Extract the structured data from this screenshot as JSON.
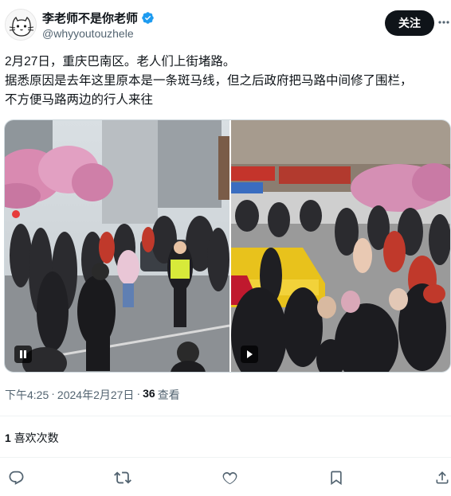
{
  "author": {
    "display_name": "李老师不是你老师",
    "handle": "@whyyoutouzhele",
    "verified": true
  },
  "follow_button_label": "关注",
  "more_icon": "more-horizontal-icon",
  "tweet": {
    "lines": [
      "2月27日，重庆巴南区。老人们上街堵路。",
      "据悉原因是去年这里原本是一条斑马线，但之后政府把马路中间修了围栏，",
      "不方便马路两边的行人来往"
    ]
  },
  "media": {
    "videos": [
      {
        "description_icon": "pause-icon"
      },
      {
        "description_icon": "play-icon"
      }
    ]
  },
  "meta": {
    "time": "下午4:25",
    "separator1": "·",
    "date": "2024年2月27日",
    "separator2": "·",
    "views_count": "36",
    "views_label": "查看"
  },
  "likes": {
    "count": "1",
    "label": "喜欢次数"
  },
  "actions": [
    "reply-icon",
    "retweet-icon",
    "like-icon",
    "bookmark-icon",
    "share-icon"
  ],
  "colors": {
    "accent": "#1d9bf0",
    "text_primary": "#0f1419",
    "text_secondary": "#536471",
    "divider": "#eff3f4"
  }
}
